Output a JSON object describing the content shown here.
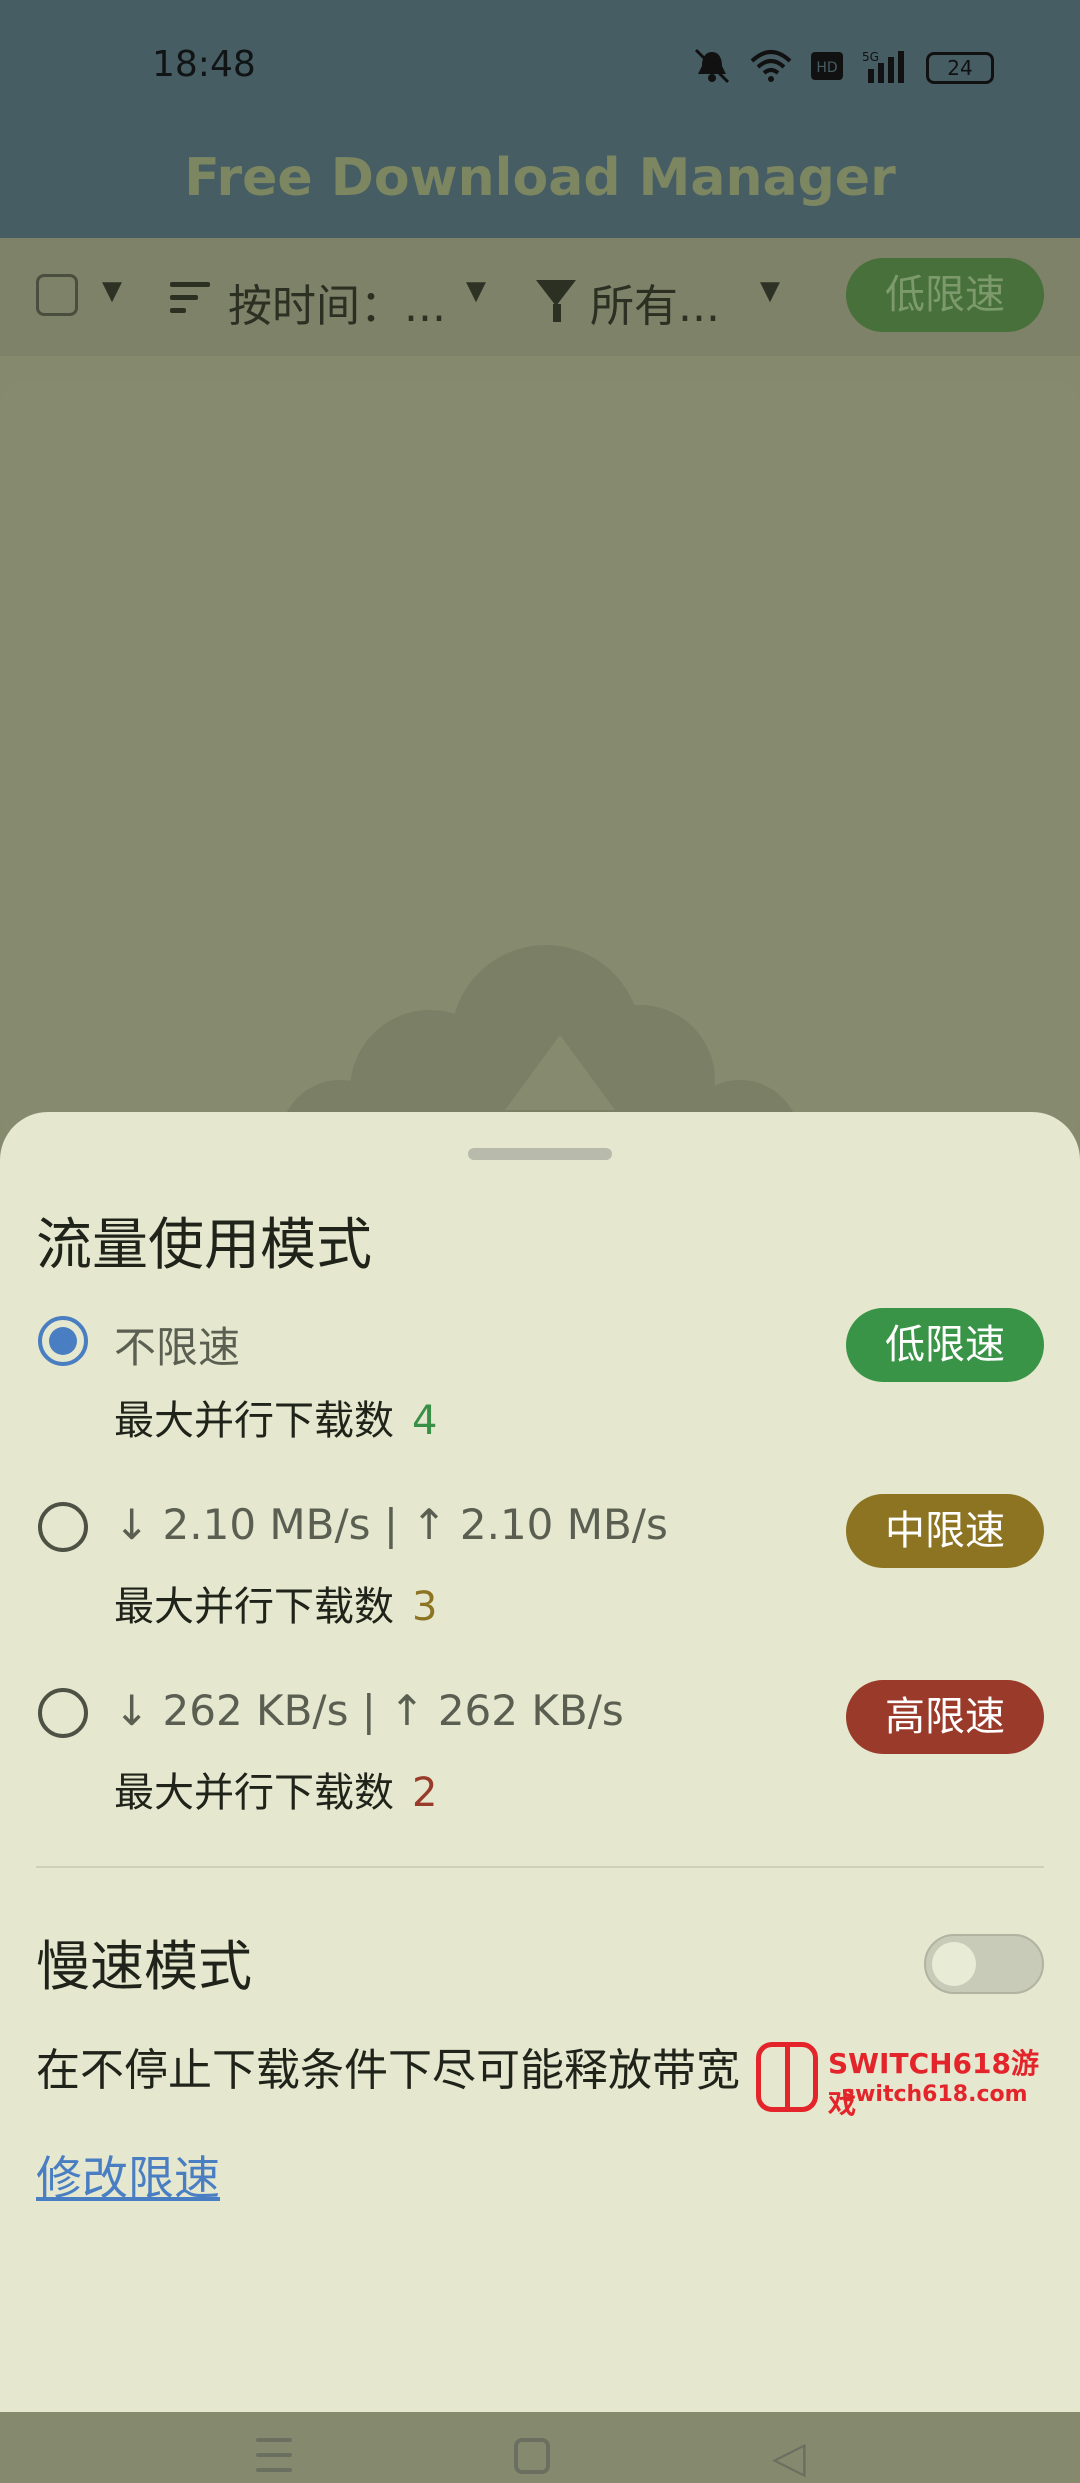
{
  "status_bar": {
    "time": "18:48",
    "battery": "24",
    "icons": [
      "mute-bell-icon",
      "wifi-icon",
      "hd-icon",
      "5g-signal-icon",
      "battery-icon"
    ]
  },
  "app_bar": {
    "title": "Free Download Manager"
  },
  "toolbar": {
    "sort_label": "按时间：...",
    "filter_label": "所有...",
    "speed_chip": "低限速"
  },
  "sheet": {
    "title": "流量使用模式",
    "options": [
      {
        "speed": "不限速",
        "sub_label": "最大并行下载数",
        "count": "4",
        "count_color": "#3a8f47",
        "chip": "低限速",
        "chip_color": "#3a9447",
        "selected": true
      },
      {
        "speed": "↓ 2.10 MB/s | ↑ 2.10 MB/s",
        "sub_label": "最大并行下载数",
        "count": "3",
        "count_color": "#8c7423",
        "chip": "中限速",
        "chip_color": "#8c7423",
        "selected": false
      },
      {
        "speed": "↓ 262 KB/s | ↑ 262 KB/s",
        "sub_label": "最大并行下载数",
        "count": "2",
        "count_color": "#9a3a2b",
        "chip": "高限速",
        "chip_color": "#9a3a2b",
        "selected": false
      }
    ],
    "slow_mode_title": "慢速模式",
    "slow_mode_on": false,
    "slow_mode_desc": "在不停止下载条件下尽可能释放带宽",
    "edit_link": "修改限速"
  },
  "watermark": {
    "line1": "SWITCH618游戏",
    "line2": "switch618.com"
  }
}
